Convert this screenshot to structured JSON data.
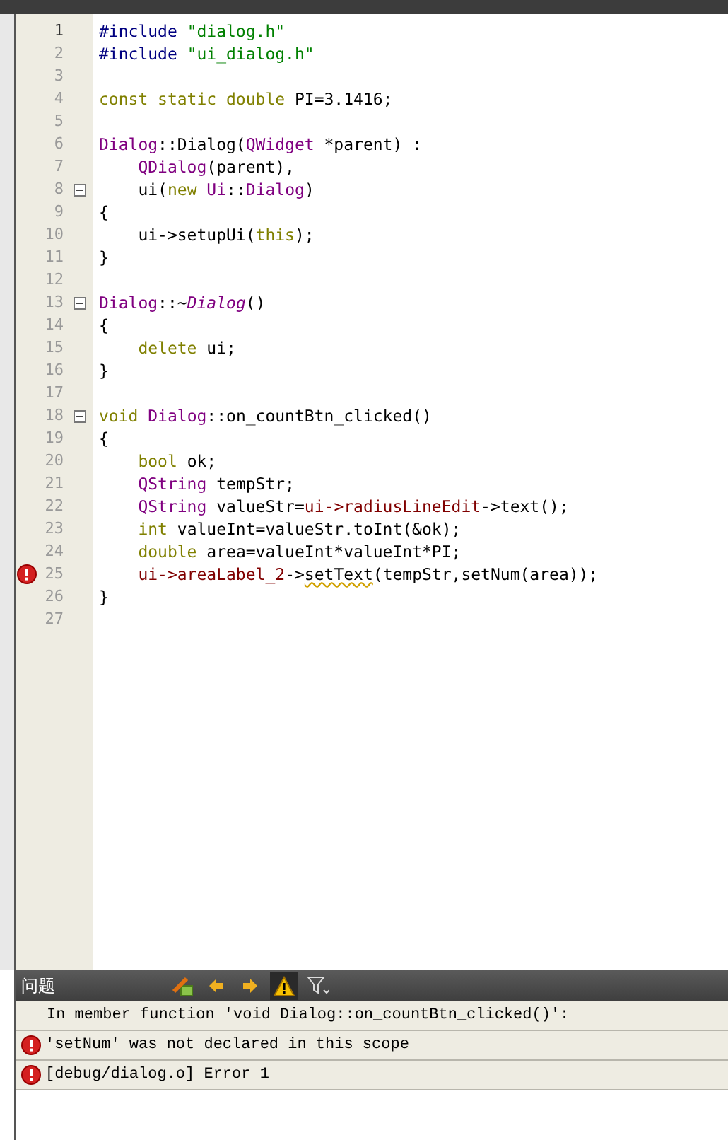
{
  "editor": {
    "lines": [
      {
        "number": "1",
        "fold_marker": false,
        "error": false,
        "tokens": [
          {
            "kind": "preproc",
            "text": "#include "
          },
          {
            "kind": "string",
            "text": "\"dialog.h\""
          }
        ]
      },
      {
        "number": "2",
        "fold_marker": false,
        "error": false,
        "tokens": [
          {
            "kind": "preproc",
            "text": "#include "
          },
          {
            "kind": "string",
            "text": "\"ui_dialog.h\""
          }
        ]
      },
      {
        "number": "3",
        "fold_marker": false,
        "error": false
      },
      {
        "number": "4",
        "fold_marker": false,
        "error": false,
        "tokens": [
          {
            "kind": "keyword",
            "text": "const static double"
          },
          {
            "kind": "plain",
            "text": " PI=3.1416;"
          }
        ]
      },
      {
        "number": "5",
        "fold_marker": false,
        "error": false
      },
      {
        "number": "6",
        "fold_marker": false,
        "error": false,
        "tokens": [
          {
            "kind": "type",
            "text": "Dialog"
          },
          {
            "kind": "plain",
            "text": "::Dialog("
          },
          {
            "kind": "qtype",
            "text": "QWidget"
          },
          {
            "kind": "plain",
            "text": " *parent) :"
          }
        ]
      },
      {
        "number": "7",
        "fold_marker": false,
        "error": false,
        "tokens": [
          {
            "kind": "qtype",
            "text": "    QDialog"
          },
          {
            "kind": "plain",
            "text": "(parent),"
          }
        ]
      },
      {
        "number": "8",
        "fold_marker": true,
        "error": false,
        "tokens": [
          {
            "kind": "plain",
            "text": "    ui("
          },
          {
            "kind": "keyword",
            "text": "new "
          },
          {
            "kind": "type",
            "text": "Ui"
          },
          {
            "kind": "plain",
            "text": "::"
          },
          {
            "kind": "type",
            "text": "Dialog"
          },
          {
            "kind": "plain",
            "text": ")"
          }
        ]
      },
      {
        "number": "9",
        "fold_marker": false,
        "error": false,
        "tokens": [
          {
            "kind": "plain",
            "text": "{"
          }
        ]
      },
      {
        "number": "10",
        "fold_marker": false,
        "error": false,
        "tokens": [
          {
            "kind": "plain",
            "text": "    ui->setupUi("
          },
          {
            "kind": "keyword",
            "text": "this"
          },
          {
            "kind": "plain",
            "text": ");"
          }
        ]
      },
      {
        "number": "11",
        "fold_marker": false,
        "error": false,
        "tokens": [
          {
            "kind": "plain",
            "text": "}"
          }
        ]
      },
      {
        "number": "12",
        "fold_marker": false,
        "error": false
      },
      {
        "number": "13",
        "fold_marker": true,
        "error": false,
        "tokens": [
          {
            "kind": "type",
            "text": "Dialog"
          },
          {
            "kind": "plain",
            "text": "::~"
          },
          {
            "kind": "italic",
            "text": "Dialog"
          },
          {
            "kind": "plain",
            "text": "()"
          }
        ]
      },
      {
        "number": "14",
        "fold_marker": false,
        "error": false,
        "tokens": [
          {
            "kind": "plain",
            "text": "{"
          }
        ]
      },
      {
        "number": "15",
        "fold_marker": false,
        "error": false,
        "tokens": [
          {
            "kind": "keyword",
            "text": "    delete"
          },
          {
            "kind": "plain",
            "text": " ui;"
          }
        ]
      },
      {
        "number": "16",
        "fold_marker": false,
        "error": false,
        "tokens": [
          {
            "kind": "plain",
            "text": "}"
          }
        ]
      },
      {
        "number": "17",
        "fold_marker": false,
        "error": false
      },
      {
        "number": "18",
        "fold_marker": true,
        "error": false,
        "tokens": [
          {
            "kind": "keyword",
            "text": "void "
          },
          {
            "kind": "type",
            "text": "Dialog"
          },
          {
            "kind": "plain",
            "text": "::on_countBtn_clicked()"
          }
        ]
      },
      {
        "number": "19",
        "fold_marker": false,
        "error": false,
        "tokens": [
          {
            "kind": "plain",
            "text": "{"
          }
        ]
      },
      {
        "number": "20",
        "fold_marker": false,
        "error": false,
        "tokens": [
          {
            "kind": "keyword",
            "text": "    bool"
          },
          {
            "kind": "plain",
            "text": " ok;"
          }
        ]
      },
      {
        "number": "21",
        "fold_marker": false,
        "error": false,
        "tokens": [
          {
            "kind": "qtype",
            "text": "    QString"
          },
          {
            "kind": "plain",
            "text": " tempStr;"
          }
        ]
      },
      {
        "number": "22",
        "fold_marker": false,
        "error": false,
        "tokens": [
          {
            "kind": "qtype",
            "text": "    QString"
          },
          {
            "kind": "plain",
            "text": " valueStr="
          },
          {
            "kind": "member",
            "text": "ui->radiusLineEdit"
          },
          {
            "kind": "plain",
            "text": "->text();"
          }
        ]
      },
      {
        "number": "23",
        "fold_marker": false,
        "error": false,
        "tokens": [
          {
            "kind": "keyword",
            "text": "    int"
          },
          {
            "kind": "plain",
            "text": " valueInt=valueStr.toInt(&ok);"
          }
        ]
      },
      {
        "number": "24",
        "fold_marker": false,
        "error": false,
        "tokens": [
          {
            "kind": "keyword",
            "text": "    double"
          },
          {
            "kind": "plain",
            "text": " area=valueInt*valueInt*PI;"
          }
        ]
      },
      {
        "number": "25",
        "fold_marker": false,
        "error": true,
        "tokens": [
          {
            "kind": "member",
            "text": "    ui->areaLabel_2"
          },
          {
            "kind": "plain",
            "text": "->"
          },
          {
            "kind": "underlined",
            "text": "setText"
          },
          {
            "kind": "plain",
            "text": "(tempStr,setNum(area));"
          }
        ]
      },
      {
        "number": "26",
        "fold_marker": false,
        "error": false,
        "tokens": [
          {
            "kind": "plain",
            "text": "}"
          }
        ]
      },
      {
        "number": "27",
        "fold_marker": false,
        "error": false
      }
    ]
  },
  "problems": {
    "title": "问题",
    "warnings_filter_on": true,
    "rows": [
      {
        "kind": "info",
        "text": "In member function 'void Dialog::on_countBtn_clicked()':"
      },
      {
        "kind": "error",
        "text": "'setNum' was not declared in this scope"
      },
      {
        "kind": "error",
        "text": "[debug/dialog.o] Error 1"
      }
    ]
  }
}
